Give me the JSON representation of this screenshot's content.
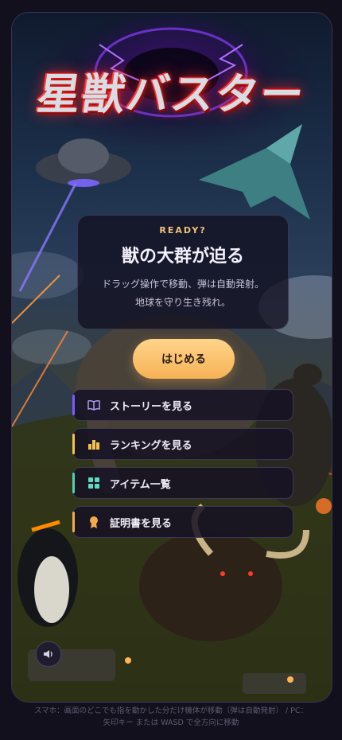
{
  "game": {
    "title_logo": "星獣バスター"
  },
  "intro_card": {
    "tag": "READY?",
    "headline": "獣の大群が迫る",
    "description_line1": "ドラッグ操作で移動、弾は自動発射。",
    "description_line2": "地球を守り生き残れ。"
  },
  "start_button": {
    "label": "はじめる"
  },
  "menu": [
    {
      "label": "ストーリーを見る",
      "icon": "book-icon",
      "accent": "#7b5cff"
    },
    {
      "label": "ランキングを見る",
      "icon": "bar-chart-icon",
      "accent": "#f2c14e"
    },
    {
      "label": "アイテム一覧",
      "icon": "grid-icon",
      "accent": "#4fd1b5"
    },
    {
      "label": "証明書を見る",
      "icon": "medal-icon",
      "accent": "#f6a94c"
    }
  ],
  "sound_button": {
    "icon": "speaker-icon"
  },
  "footer": {
    "line1": "スマホ：画面のどこでも指を動かした分だけ機体が移動（弾は自動発射） / PC：",
    "line2": "矢印キー または WASD で全方向に移動"
  },
  "colors": {
    "accent_gold": "#f6b256",
    "ready_text": "#f2c27c",
    "card_bg": "#121020"
  }
}
